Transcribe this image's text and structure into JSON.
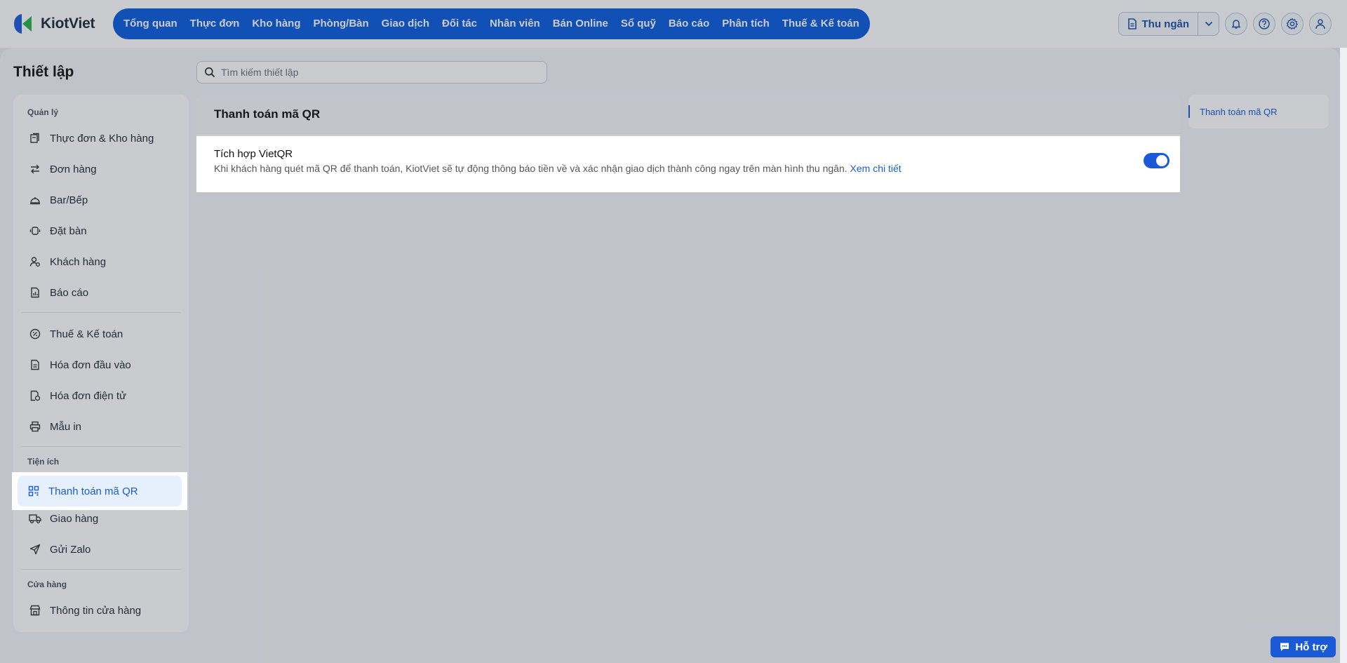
{
  "brand": {
    "name": "KiotViet"
  },
  "nav": {
    "items": [
      "Tổng quan",
      "Thực đơn",
      "Kho hàng",
      "Phòng/Bàn",
      "Giao dịch",
      "Đối tác",
      "Nhân viên",
      "Bán Online",
      "Sổ quỹ",
      "Báo cáo",
      "Phân tích",
      "Thuế & Kế toán"
    ]
  },
  "header_actions": {
    "cashier_label": "Thu ngân"
  },
  "page": {
    "title": "Thiết lập",
    "search_placeholder": "Tìm kiếm thiết lập"
  },
  "sidebar": {
    "section_manage": "Quản lý",
    "manage_items": [
      "Thực đơn & Kho hàng",
      "Đơn hàng",
      "Bar/Bếp",
      "Đặt bàn",
      "Khách hàng",
      "Báo cáo"
    ],
    "accounting_items": [
      "Thuế & Kế toán",
      "Hóa đơn đầu vào",
      "Hóa đơn điện tử",
      "Mẫu in"
    ],
    "section_utility": "Tiện ích",
    "utility_items": [
      "Thanh toán mã QR",
      "Giao hàng",
      "Gửi Zalo"
    ],
    "section_store": "Cửa hàng",
    "store_items": [
      "Thông tin cửa hàng"
    ]
  },
  "panel": {
    "title": "Thanh toán mã QR",
    "row_title": "Tích hợp VietQR",
    "row_desc": "Khi khách hàng quét mã QR để thanh toán, KiotViet sẽ tự động thông báo tiền về và xác nhận giao dịch thành công ngay trên màn hình thu ngân.",
    "row_link": "Xem chi tiết",
    "toggle_on": true
  },
  "anchor_nav": {
    "item": "Thanh toán mã QR"
  },
  "support": {
    "label": "Hỗ trợ"
  },
  "colors": {
    "primary": "#0a5bdc",
    "link": "#1a5ad7"
  }
}
